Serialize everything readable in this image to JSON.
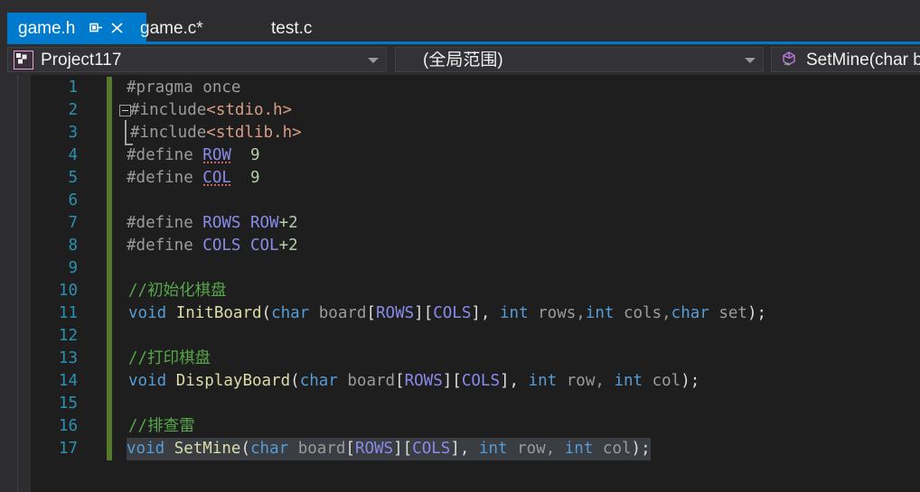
{
  "window": {
    "accent_color": "#007acc",
    "editor_background": "#1e1e1e",
    "chrome_background": "#2d2d30"
  },
  "tabs": [
    {
      "label": "game.h",
      "active": true,
      "modified": false,
      "pin_icon": "pin-icon",
      "close_icon": "close-icon"
    },
    {
      "label": "game.c*",
      "active": false,
      "modified": true
    },
    {
      "label": "test.c",
      "active": false,
      "modified": false
    }
  ],
  "navbar": {
    "project": {
      "value": "Project117",
      "icon": "cpp-project-icon"
    },
    "scope": {
      "value": "(全局范围)"
    },
    "member": {
      "value": "SetMine(char bo",
      "icon": "method-icon"
    }
  },
  "editor": {
    "selected_line": 17,
    "lines": [
      {
        "no": "1",
        "text": "#pragma once"
      },
      {
        "no": "2",
        "text": "#include<stdio.h>"
      },
      {
        "no": "3",
        "text": "#include<stdlib.h>"
      },
      {
        "no": "4",
        "text": "#define ROW  9"
      },
      {
        "no": "5",
        "text": "#define COL  9"
      },
      {
        "no": "6",
        "text": ""
      },
      {
        "no": "7",
        "text": "#define ROWS ROW+2"
      },
      {
        "no": "8",
        "text": "#define COLS COL+2"
      },
      {
        "no": "9",
        "text": ""
      },
      {
        "no": "10",
        "text": "//初始化棋盘"
      },
      {
        "no": "11",
        "text": "void InitBoard(char board[ROWS][COLS], int rows,int cols,char set);"
      },
      {
        "no": "12",
        "text": ""
      },
      {
        "no": "13",
        "text": "//打印棋盘"
      },
      {
        "no": "14",
        "text": "void DisplayBoard(char board[ROWS][COLS], int row, int col);"
      },
      {
        "no": "15",
        "text": ""
      },
      {
        "no": "16",
        "text": "//排查雷"
      },
      {
        "no": "17",
        "text": "void SetMine(char board[ROWS][COLS], int row, int col);"
      }
    ],
    "colors": {
      "line_number": "#2b91af",
      "change_bar": "#57792e",
      "comment": "#57a64a",
      "keyword": "#569cd6",
      "macro": "#8a8aea",
      "number": "#b5cea8",
      "string": "#d69d85",
      "function": "#dcdcaa",
      "selection": "#3a3d41"
    }
  }
}
